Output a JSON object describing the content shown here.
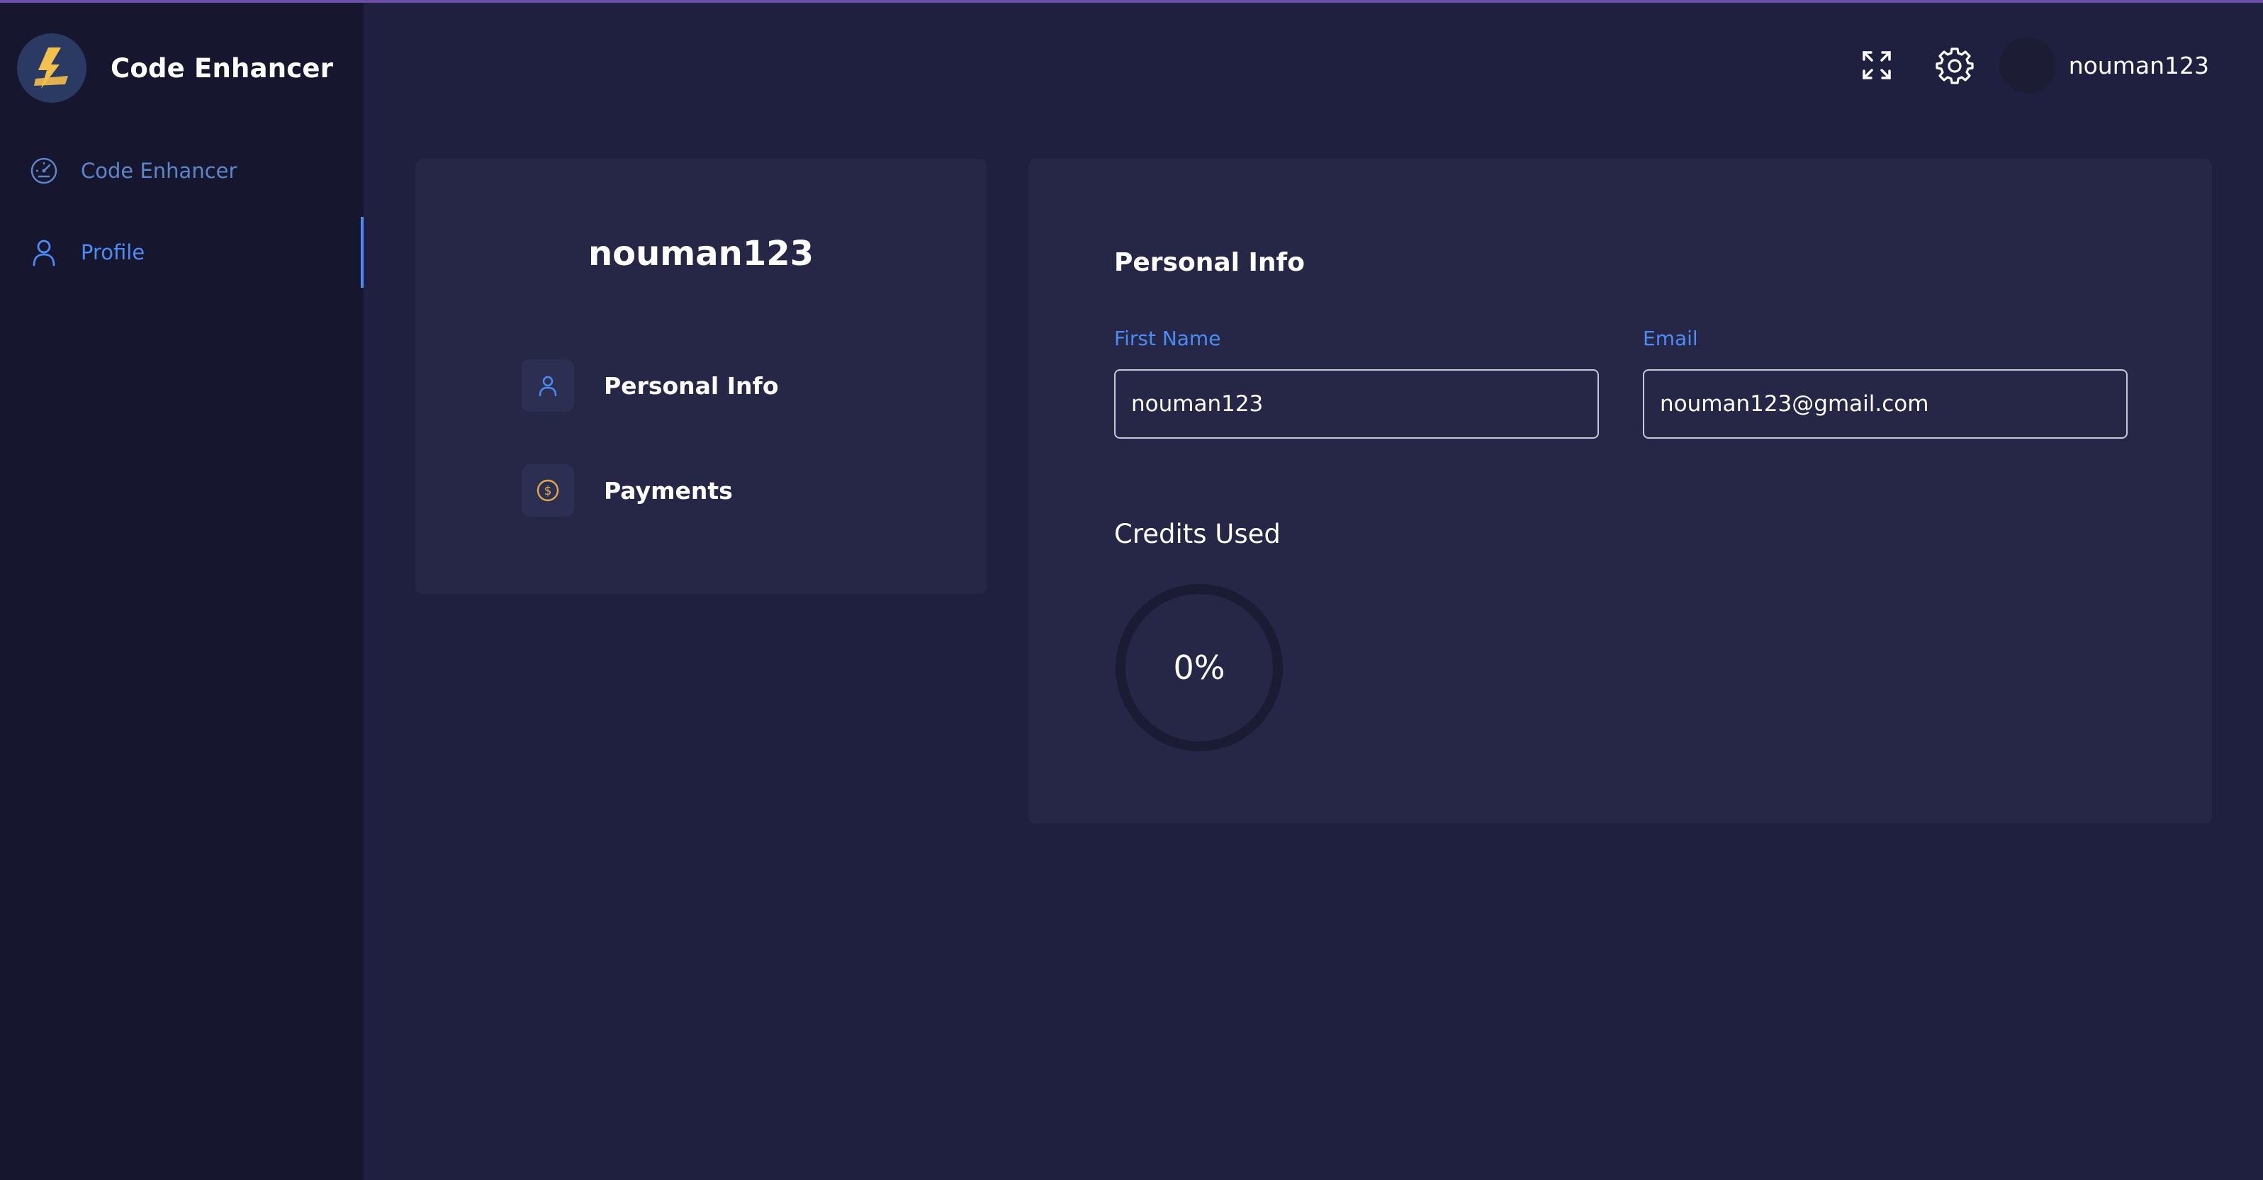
{
  "app": {
    "name": "Code Enhancer"
  },
  "sidebar": {
    "items": [
      {
        "label": "Code Enhancer",
        "icon": "dashboard-gauge-icon",
        "active": false
      },
      {
        "label": "Profile",
        "icon": "user-icon",
        "active": true
      }
    ]
  },
  "header": {
    "username": "nouman123",
    "icons": [
      "fullscreen-icon",
      "gear-icon",
      "avatar"
    ]
  },
  "profile_card": {
    "name": "nouman123",
    "menu": [
      {
        "label": "Personal Info",
        "icon": "user-icon"
      },
      {
        "label": "Payments",
        "icon": "dollar-coin-icon"
      }
    ]
  },
  "personal_info": {
    "title": "Personal Info",
    "first_name_label": "First Name",
    "first_name_value": "nouman123",
    "email_label": "Email",
    "email_value": "nouman123@gmail.com"
  },
  "credits": {
    "title": "Credits Used",
    "percent": 0,
    "percent_text": "0%"
  },
  "colors": {
    "background": "#1f2040",
    "sidebar": "#16172f",
    "card": "#262747",
    "accent": "#4d8cf5",
    "logo_bolt": "#f2c14e",
    "payments_icon": "#e2a94a"
  }
}
